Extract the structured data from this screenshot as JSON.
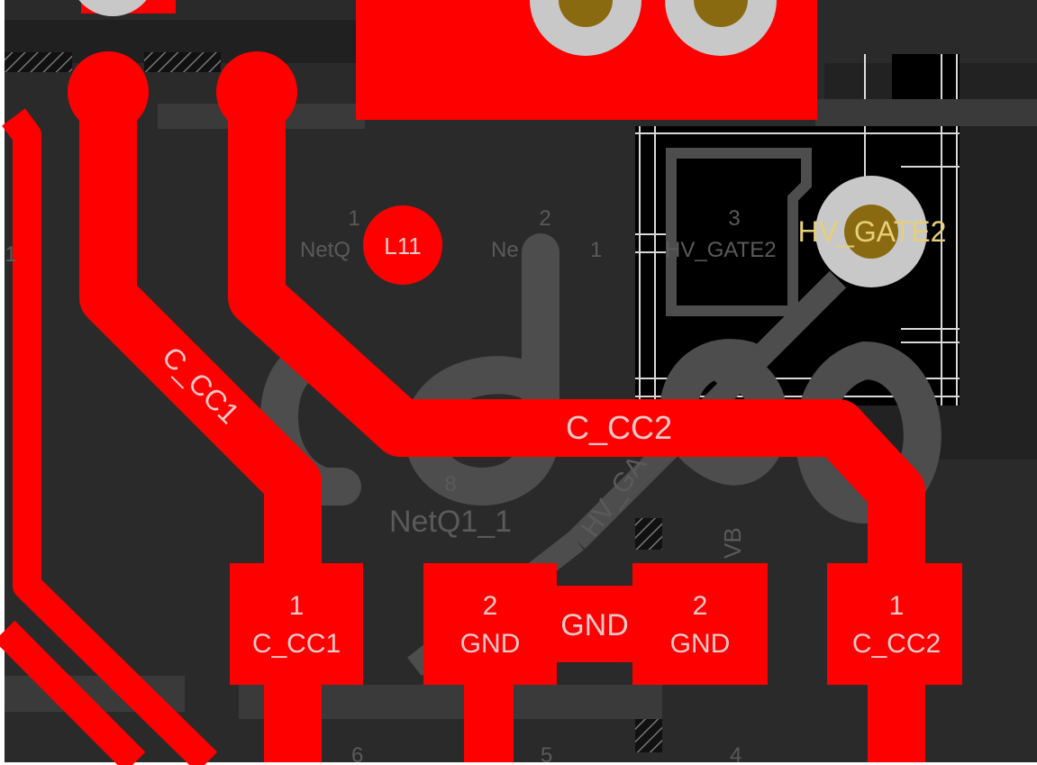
{
  "colors": {
    "board": "#2a2a2a",
    "copper_top": "#ff0000",
    "silkscreen_gray": "#4d4d4d",
    "pad_label": "#f2c9c9",
    "net_label_yellow": "#e6cf7a",
    "via_ring": "#c8c8c8",
    "via_hole": "#8a6a10",
    "keepout_black": "#000000",
    "grid_white": "#ffffff",
    "dim_text": "#5a5a5a"
  },
  "component_designators": {
    "l11": "L11"
  },
  "silkscreen_pin_numbers": {
    "pin1": "1",
    "pin2": "2",
    "pin3": "3",
    "left_edge_digit": "1",
    "bottom_8": "8"
  },
  "silkscreen_net_names": {
    "netq_top_left": "NetQ",
    "netq_top_mid_a": "Ne",
    "netq_top_mid_b": "1",
    "hv_gate2_outline": "HV_GATE2",
    "netq1_1": "NetQ1_1",
    "hv_gate_diag": "HV_GA",
    "vbus_vert": "VB"
  },
  "trace_labels": {
    "c_cc1": "C_CC1",
    "c_cc2": "C_CC2",
    "gnd_bridge": "GND",
    "hv_gate2_via": "HV_GATE2"
  },
  "pads": [
    {
      "id": "pad-c-cc1",
      "pin": "1",
      "net": "C_CC1"
    },
    {
      "id": "pad-gnd-left",
      "pin": "2",
      "net": "GND"
    },
    {
      "id": "pad-gnd-right",
      "pin": "2",
      "net": "GND"
    },
    {
      "id": "pad-c-cc2",
      "pin": "1",
      "net": "C_CC2"
    }
  ],
  "bottom_fragments": {
    "a": "6",
    "b": "5",
    "c": "4"
  }
}
